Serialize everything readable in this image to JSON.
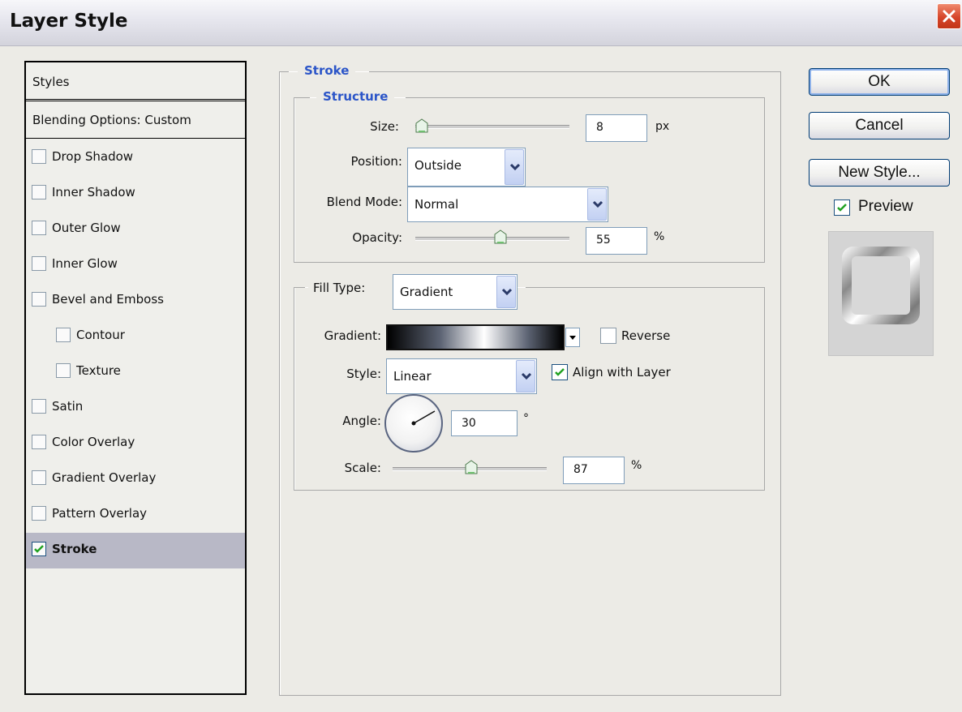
{
  "window": {
    "title": "Layer Style",
    "close_icon": "close-x-icon"
  },
  "styles_panel": {
    "header": "Styles",
    "blending_options": "Blending Options: Custom",
    "items": [
      {
        "label": "Drop Shadow",
        "checked": false,
        "indent": 0
      },
      {
        "label": "Inner Shadow",
        "checked": false,
        "indent": 0
      },
      {
        "label": "Outer Glow",
        "checked": false,
        "indent": 0
      },
      {
        "label": "Inner Glow",
        "checked": false,
        "indent": 0
      },
      {
        "label": "Bevel and Emboss",
        "checked": false,
        "indent": 0
      },
      {
        "label": "Contour",
        "checked": false,
        "indent": 1
      },
      {
        "label": "Texture",
        "checked": false,
        "indent": 1
      },
      {
        "label": "Satin",
        "checked": false,
        "indent": 0
      },
      {
        "label": "Color Overlay",
        "checked": false,
        "indent": 0
      },
      {
        "label": "Gradient Overlay",
        "checked": false,
        "indent": 0
      },
      {
        "label": "Pattern Overlay",
        "checked": false,
        "indent": 0
      },
      {
        "label": "Stroke",
        "checked": true,
        "indent": 0,
        "selected": true
      }
    ]
  },
  "stroke": {
    "title": "Stroke",
    "structure": {
      "title": "Structure",
      "size_label": "Size:",
      "size_value": "8",
      "size_unit": "px",
      "size_slider_fraction": 0.04,
      "position_label": "Position:",
      "position_value": "Outside",
      "blend_mode_label": "Blend Mode:",
      "blend_mode_value": "Normal",
      "opacity_label": "Opacity:",
      "opacity_value": "55",
      "opacity_unit": "%",
      "opacity_slider_fraction": 0.55
    },
    "fill": {
      "fill_type_label": "Fill Type:",
      "fill_type_value": "Gradient",
      "gradient_label": "Gradient:",
      "reverse_label": "Reverse",
      "reverse_checked": false,
      "style_label": "Style:",
      "style_value": "Linear",
      "align_label": "Align with Layer",
      "align_checked": true,
      "angle_label": "Angle:",
      "angle_value": "30",
      "angle_unit": "°",
      "scale_label": "Scale:",
      "scale_value": "87",
      "scale_unit": "%",
      "scale_slider_fraction": 0.51
    }
  },
  "buttons": {
    "ok": "OK",
    "cancel": "Cancel",
    "new_style": "New Style..."
  },
  "preview": {
    "label": "Preview",
    "checked": true
  },
  "colors": {
    "accent_blue": "#2b55c8",
    "selected_row": "#b8b8c6",
    "check_green": "#21a121",
    "close_red": "#d6452a"
  }
}
